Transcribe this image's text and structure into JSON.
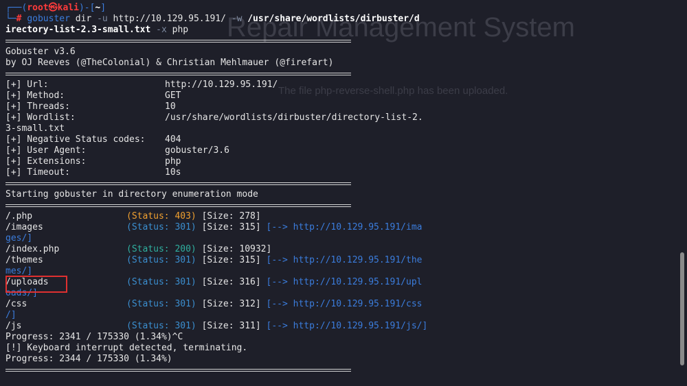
{
  "background": {
    "title": "Repair Management System",
    "message": "The file php-reverse-shell.php has been uploaded."
  },
  "prompt": {
    "corner_top": "┌──(",
    "user": "root㉿kali",
    "mid": ")-[",
    "dir": "~",
    "end": "]",
    "corner_bottom": "└─",
    "hash": "#",
    "cmd_name": "gobuster",
    "cmd_dir": " dir ",
    "flag_u": "-u",
    "url": " http://10.129.95.191/ ",
    "flag_w": "-w",
    "wordlist_part1": " /usr/share/wordlists/dirbuster/d",
    "wordlist_part2": "irectory-list-2.3-small.txt",
    "flag_x": " -x",
    "ext": " php"
  },
  "banner": {
    "version": "Gobuster v3.6",
    "authors": "by OJ Reeves (@TheColonial) & Christian Mehlmauer (@firefart)"
  },
  "config": [
    {
      "key": "[+] Url:",
      "value": "http://10.129.95.191/"
    },
    {
      "key": "[+] Method:",
      "value": "GET"
    },
    {
      "key": "[+] Threads:",
      "value": "10"
    },
    {
      "key": "[+] Wordlist:",
      "value": "/usr/share/wordlists/dirbuster/directory-list-2."
    },
    {
      "key": "3-small.txt",
      "value": ""
    },
    {
      "key": "[+] Negative Status codes:",
      "value": "404"
    },
    {
      "key": "[+] User Agent:",
      "value": "gobuster/3.6"
    },
    {
      "key": "[+] Extensions:",
      "value": "php"
    },
    {
      "key": "[+] Timeout:",
      "value": "10s"
    }
  ],
  "mode_line": "Starting gobuster in directory enumeration mode",
  "results": [
    {
      "path": "/.php",
      "status": "(Status: 403)",
      "size": " [Size: 278]",
      "redirect": "",
      "wrap": ""
    },
    {
      "path": "/images",
      "status": "(Status: 301)",
      "size": " [Size: 315]",
      "redirect": " [--> http://10.129.95.191/ima",
      "wrap": "ges/]"
    },
    {
      "path": "/index.php",
      "status": "(Status: 200)",
      "size": " [Size: 10932]",
      "redirect": "",
      "wrap": ""
    },
    {
      "path": "/themes",
      "status": "(Status: 301)",
      "size": " [Size: 315]",
      "redirect": " [--> http://10.129.95.191/the",
      "wrap": "mes/]"
    },
    {
      "path": "/uploads",
      "status": "(Status: 301)",
      "size": " [Size: 316]",
      "redirect": " [--> http://10.129.95.191/upl",
      "wrap": "oads/]"
    },
    {
      "path": "/css",
      "status": "(Status: 301)",
      "size": " [Size: 312]",
      "redirect": " [--> http://10.129.95.191/css",
      "wrap": "/]"
    },
    {
      "path": "/js",
      "status": "(Status: 301)",
      "size": " [Size: 311]",
      "redirect": " [--> http://10.129.95.191/js/]",
      "wrap": ""
    }
  ],
  "footer": [
    "Progress: 2341 / 175330 (1.34%)^C",
    "[!] Keyboard interrupt detected, terminating.",
    "Progress: 2344 / 175330 (1.34%)"
  ],
  "colors": {
    "background": "#1e1f29",
    "prompt_blue": "#3b7ddd",
    "prompt_red": "#ff3b3b",
    "status_403": "#f0a030",
    "status_301": "#3b8fd0",
    "status_200": "#2fb0a0",
    "highlight": "#e03030"
  }
}
